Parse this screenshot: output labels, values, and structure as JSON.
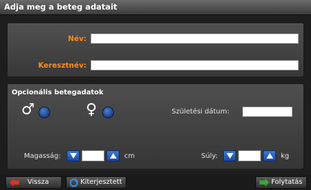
{
  "window": {
    "title": "Adja meg a beteg adatait"
  },
  "name_section": {
    "nev_label": "Név:",
    "nev_value": "",
    "keresztnev_label": "Keresztnév:",
    "keresztnev_value": ""
  },
  "optional_section": {
    "title": "Opcionális betegadatok",
    "male_symbol": "♂",
    "female_symbol": "♀",
    "birthdate_label": "Születési dátum:",
    "birthdate_value": "",
    "height_label": "Magasság:",
    "height_value": "",
    "height_unit": "cm",
    "weight_label": "Súly:",
    "weight_value": "",
    "weight_unit": "kg"
  },
  "footer": {
    "back_label": "Vissza",
    "expanded_label": "Kiterjesztett",
    "continue_label": "Folytatás"
  },
  "icons": {
    "back": "arrow-left-icon",
    "expanded": "refresh-icon",
    "continue": "arrow-right-icon",
    "spin_down": "triangle-down-icon",
    "spin_up": "triangle-up-icon"
  },
  "colors": {
    "label_orange": "#ff8c1a",
    "radio_blue": "#1b3f86",
    "spin_blue": "#2a62bf",
    "back_arrow_red": "#e0302a",
    "continue_arrow_green": "#3aa63a"
  }
}
